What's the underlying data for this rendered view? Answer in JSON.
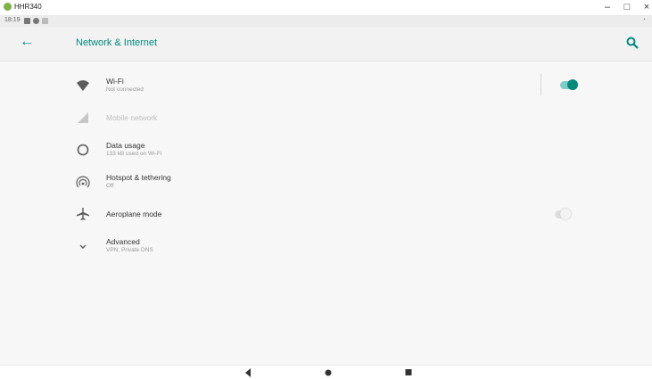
{
  "window": {
    "title": "HHR340"
  },
  "status_bar": {
    "time": "18:19"
  },
  "app_bar": {
    "title": "Network & Internet"
  },
  "colors": {
    "accent": "#00897b"
  },
  "items": [
    {
      "title": "Wi-Fi",
      "subtitle": "Not connected",
      "icon": "wifi-icon",
      "toggle": true
    },
    {
      "title": "Mobile network",
      "subtitle": "",
      "icon": "cellular-signal-icon",
      "disabled": true
    },
    {
      "title": "Data usage",
      "subtitle": "133 kB used on Wi-Fi",
      "icon": "data-usage-icon"
    },
    {
      "title": "Hotspot & tethering",
      "subtitle": "Off",
      "icon": "hotspot-icon"
    },
    {
      "title": "Aeroplane mode",
      "subtitle": "",
      "icon": "airplane-icon",
      "toggle": false
    },
    {
      "title": "Advanced",
      "subtitle": "VPN, Private DNS",
      "icon": "chevron-down-icon"
    }
  ]
}
